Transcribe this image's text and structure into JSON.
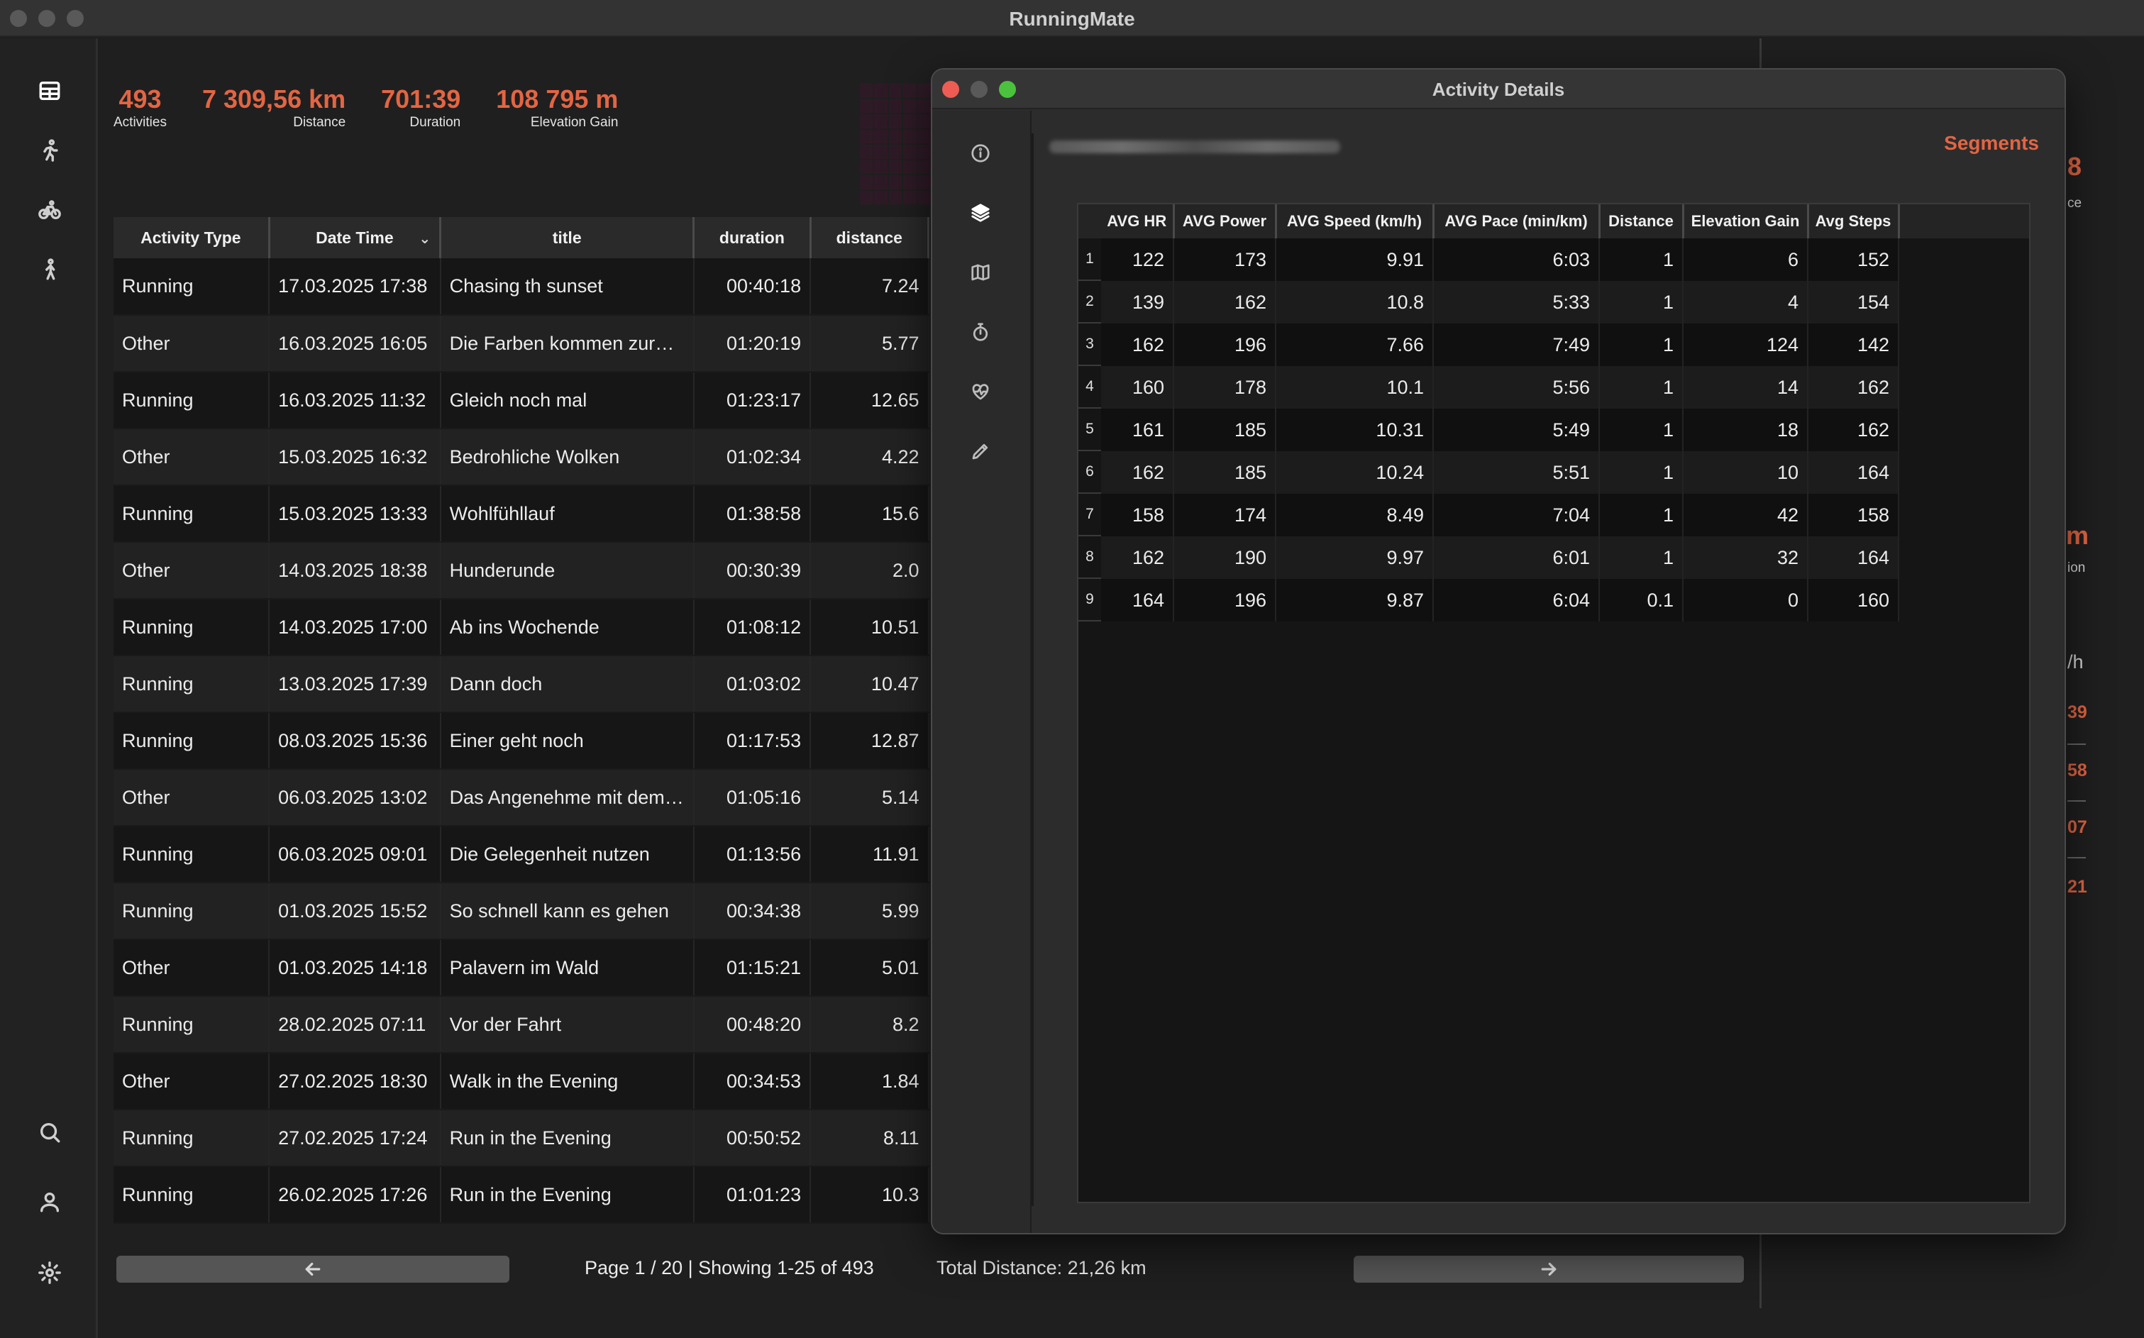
{
  "window": {
    "title": "RunningMate"
  },
  "sidebar": {
    "items": [
      {
        "icon": "dashboard-icon"
      },
      {
        "icon": "running-icon"
      },
      {
        "icon": "cycling-icon"
      },
      {
        "icon": "walking-icon"
      },
      {
        "icon": "search-icon"
      },
      {
        "icon": "user-icon"
      },
      {
        "icon": "gear-icon"
      }
    ]
  },
  "stats": [
    {
      "value": "493",
      "label": "Activities"
    },
    {
      "value": "7 309,56 km",
      "label": "Distance"
    },
    {
      "value": "701:39",
      "label": "Duration"
    },
    {
      "value": "108 795 m",
      "label": "Elevation Gain"
    }
  ],
  "activities": {
    "columns": [
      "Activity Type",
      "Date Time",
      "title",
      "duration",
      "distance"
    ],
    "rows": [
      [
        "Running",
        "17.03.2025 17:38",
        "Chasing th sunset",
        "00:40:18",
        "7.24"
      ],
      [
        "Other",
        "16.03.2025 16:05",
        "Die Farben kommen zurück",
        "01:20:19",
        "5.77"
      ],
      [
        "Running",
        "16.03.2025 11:32",
        "Gleich noch mal",
        "01:23:17",
        "12.65"
      ],
      [
        "Other",
        "15.03.2025 16:32",
        "Bedrohliche Wolken",
        "01:02:34",
        "4.22"
      ],
      [
        "Running",
        "15.03.2025 13:33",
        "Wohlfühllauf",
        "01:38:58",
        "15.6"
      ],
      [
        "Other",
        "14.03.2025 18:38",
        "Hunderunde",
        "00:30:39",
        "2.0"
      ],
      [
        "Running",
        "14.03.2025 17:00",
        "Ab ins Wochende",
        "01:08:12",
        "10.51"
      ],
      [
        "Running",
        "13.03.2025 17:39",
        "Dann doch",
        "01:03:02",
        "10.47"
      ],
      [
        "Running",
        "08.03.2025 15:36",
        "Einer geht noch",
        "01:17:53",
        "12.87"
      ],
      [
        "Other",
        "06.03.2025 13:02",
        "Das Angenehme mit dem ...",
        "01:05:16",
        "5.14"
      ],
      [
        "Running",
        "06.03.2025 09:01",
        "Die Gelegenheit nutzen",
        "01:13:56",
        "11.91"
      ],
      [
        "Running",
        "01.03.2025 15:52",
        "So schnell kann es gehen",
        "00:34:38",
        "5.99"
      ],
      [
        "Other",
        "01.03.2025 14:18",
        "Palavern im Wald",
        "01:15:21",
        "5.01"
      ],
      [
        "Running",
        "28.02.2025 07:11",
        "Vor der Fahrt",
        "00:48:20",
        "8.2"
      ],
      [
        "Other",
        "27.02.2025 18:30",
        "Walk in the Evening",
        "00:34:53",
        "1.84"
      ],
      [
        "Running",
        "27.02.2025 17:24",
        "Run in the Evening",
        "00:50:52",
        "8.11"
      ],
      [
        "Running",
        "26.02.2025 17:26",
        "Run in the Evening",
        "01:01:23",
        "10.3"
      ]
    ]
  },
  "pagination": {
    "page_info": "Page 1 / 20 | Showing 1-25 of 493",
    "total_distance": "Total Distance: 21,26 km",
    "prev_icon": "arrow-left-icon",
    "next_icon": "arrow-right-icon"
  },
  "peek": {
    "a": "8",
    "b": "ce",
    "c": "m",
    "d": "ion",
    "e": "/h",
    "f": "39",
    "g": "58",
    "h": "07",
    "i": "21"
  },
  "dialog": {
    "title": "Activity Details",
    "section_title": "Segments",
    "tabs": [
      {
        "icon": "info-icon"
      },
      {
        "icon": "layers-icon"
      },
      {
        "icon": "map-icon"
      },
      {
        "icon": "stopwatch-icon"
      },
      {
        "icon": "heart-rate-icon"
      },
      {
        "icon": "pencil-icon"
      }
    ],
    "segments": {
      "columns": [
        "AVG HR",
        "AVG Power",
        "AVG Speed (km/h)",
        "AVG Pace (min/km)",
        "Distance",
        "Elevation Gain",
        "Avg Steps"
      ],
      "rows": [
        [
          "122",
          "173",
          "9.91",
          "6:03",
          "1",
          "6",
          "152"
        ],
        [
          "139",
          "162",
          "10.8",
          "5:33",
          "1",
          "4",
          "154"
        ],
        [
          "162",
          "196",
          "7.66",
          "7:49",
          "1",
          "124",
          "142"
        ],
        [
          "160",
          "178",
          "10.1",
          "5:56",
          "1",
          "14",
          "162"
        ],
        [
          "161",
          "185",
          "10.31",
          "5:49",
          "1",
          "18",
          "162"
        ],
        [
          "162",
          "185",
          "10.24",
          "5:51",
          "1",
          "10",
          "164"
        ],
        [
          "158",
          "174",
          "8.49",
          "7:04",
          "1",
          "42",
          "158"
        ],
        [
          "162",
          "190",
          "9.97",
          "6:01",
          "1",
          "32",
          "164"
        ],
        [
          "164",
          "196",
          "9.87",
          "6:04",
          "0.1",
          "0",
          "160"
        ]
      ],
      "row_numbers": [
        "1",
        "2",
        "3",
        "4",
        "5",
        "6",
        "7",
        "8",
        "9"
      ]
    }
  },
  "colors": {
    "accent": "#e36543",
    "heatmap": "#5a1f3f"
  }
}
